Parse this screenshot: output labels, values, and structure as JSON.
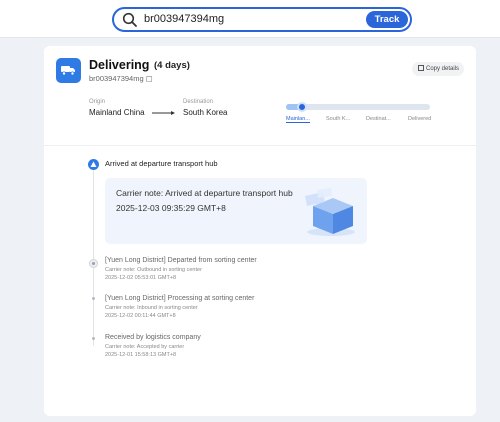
{
  "search": {
    "value": "br003947394mg",
    "track_label": "Track"
  },
  "status": {
    "title": "Delivering",
    "days": "(4 days)",
    "tracking_number": "br003947394mg",
    "copy_label": "Copy details",
    "accent": "#2f7be5"
  },
  "route": {
    "origin_label": "Origin",
    "origin": "Mainland China",
    "destination_label": "Destination",
    "destination": "South Korea"
  },
  "progress": {
    "fraction": 0.08,
    "steps": [
      {
        "label": "Mainlan...",
        "active": true
      },
      {
        "label": "South K...",
        "active": false
      },
      {
        "label": "Destinat...",
        "active": false
      },
      {
        "label": "Delivered",
        "active": false
      }
    ]
  },
  "timeline": {
    "current": {
      "title": "Arrived at departure transport hub",
      "note": "Carrier note: Arrived at departure transport hub",
      "time": "2025-12-03 09:35:29 GMT+8"
    },
    "events": [
      {
        "title": "[Yuen Long District] Departed from sorting center",
        "note": "Carrier note: Outbound in sorting center",
        "time": "2025-12-02 05:53:01 GMT+8"
      },
      {
        "title": "[Yuen Long District] Processing at sorting center",
        "note": "Carrier note: Inbound in sorting center",
        "time": "2025-12-02 00:11:44 GMT+8"
      },
      {
        "title": "Received by logistics company",
        "note": "Carrier note: Accepted by carrier",
        "time": "2025-12-01 15:58:13 GMT+8"
      }
    ]
  }
}
